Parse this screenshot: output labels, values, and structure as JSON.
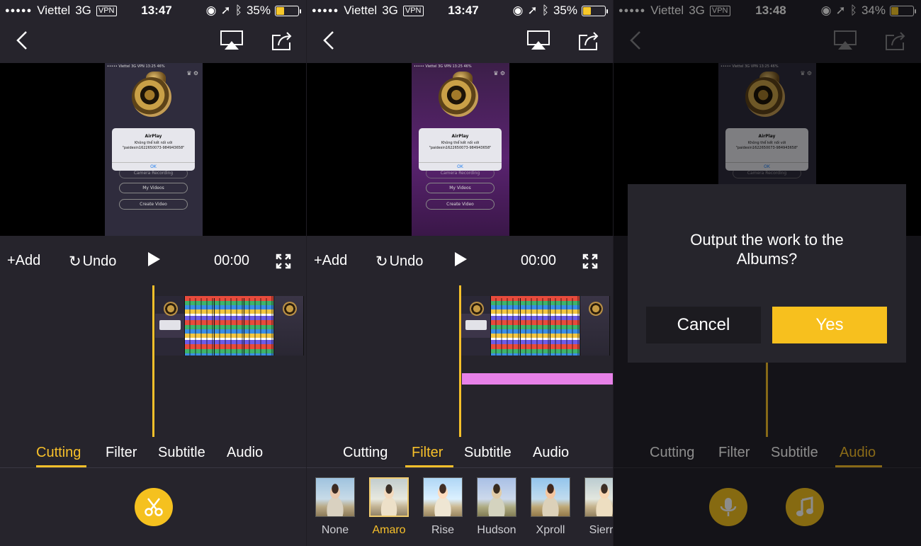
{
  "panels": [
    {
      "status": {
        "carrier": "Viettel",
        "network": "3G",
        "vpn": "VPN",
        "time": "13:47",
        "battery": "35%",
        "battery_level": 0.35
      },
      "controls": {
        "add": "+Add",
        "undo": "Undo",
        "time": "00:00"
      },
      "tabs": [
        "Cutting",
        "Filter",
        "Subtitle",
        "Audio"
      ],
      "active_tab": "Cutting"
    },
    {
      "status": {
        "carrier": "Viettel",
        "network": "3G",
        "vpn": "VPN",
        "time": "13:47",
        "battery": "35%",
        "battery_level": 0.35
      },
      "controls": {
        "add": "+Add",
        "undo": "Undo",
        "time": "00:00"
      },
      "tabs": [
        "Cutting",
        "Filter",
        "Subtitle",
        "Audio"
      ],
      "active_tab": "Filter",
      "filters": [
        "None",
        "Amaro",
        "Rise",
        "Hudson",
        "Xproll",
        "Sierra"
      ],
      "selected_filter": "Amaro"
    },
    {
      "status": {
        "carrier": "Viettel",
        "network": "3G",
        "vpn": "VPN",
        "time": "13:48",
        "battery": "34%",
        "battery_level": 0.34
      },
      "tabs": [
        "Cutting",
        "Filter",
        "Subtitle",
        "Audio"
      ],
      "active_tab": "Audio",
      "dialog": {
        "message": "Output the work to the Albums?",
        "cancel": "Cancel",
        "yes": "Yes"
      }
    }
  ],
  "preview_screen": {
    "alert_title": "AirPlay",
    "alert_message_1": "Không thể kết nối với",
    "alert_message_2": "\"paidesin1622650073-984943658\"",
    "alert_ok": "OK",
    "btn_camera": "Camera Recording",
    "btn_videos": "My Videos",
    "btn_create": "Create Video",
    "status": "••••• Viettel 3G VPN 13:25 46%"
  },
  "colors": {
    "accent": "#f7c02a",
    "panel_bg": "#26242c",
    "audio_track": "#e781e8"
  }
}
